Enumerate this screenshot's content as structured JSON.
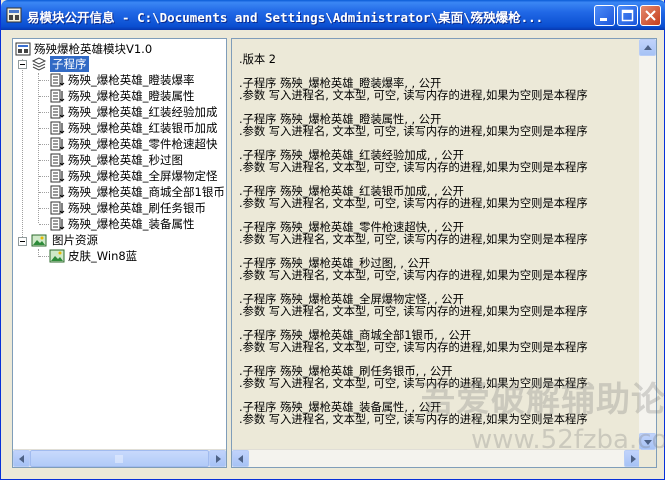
{
  "window": {
    "title": "易模块公开信息 - C:\\Documents and Settings\\Administrator\\桌面\\殇殃爆枪..."
  },
  "tree": {
    "root": "殇殃爆枪英雄模块V1.0",
    "subprograms_label": "子程序",
    "subprograms": [
      "殇殃_爆枪英雄_瞪装爆率",
      "殇殃_爆枪英雄_瞪装属性",
      "殇殃_爆枪英雄_红装经验加成",
      "殇殃_爆枪英雄_红装银币加成",
      "殇殃_爆枪英雄_零件枪速超快",
      "殇殃_爆枪英雄_秒过图",
      "殇殃_爆枪英雄_全屏爆物定怪",
      "殇殃_爆枪英雄_商城全部1银币",
      "殇殃_爆枪英雄_刷任务银币",
      "殇殃_爆枪英雄_装备属性"
    ],
    "images_label": "图片资源",
    "images": [
      "皮肤_Win8蓝"
    ]
  },
  "content": {
    "version": ".版本 2",
    "entries": [
      {
        "sub": ".子程序 殇殃_爆枪英雄_瞪装爆率, , 公开",
        "param": ".参数 写入进程名, 文本型, 可空, 读写内存的进程,如果为空则是本程序"
      },
      {
        "sub": ".子程序 殇殃_爆枪英雄_瞪装属性, , 公开",
        "param": ".参数 写入进程名, 文本型, 可空, 读写内存的进程,如果为空则是本程序"
      },
      {
        "sub": ".子程序 殇殃_爆枪英雄_红装经验加成, , 公开",
        "param": ".参数 写入进程名, 文本型, 可空, 读写内存的进程,如果为空则是本程序"
      },
      {
        "sub": ".子程序 殇殃_爆枪英雄_红装银币加成, , 公开",
        "param": ".参数 写入进程名, 文本型, 可空, 读写内存的进程,如果为空则是本程序"
      },
      {
        "sub": ".子程序 殇殃_爆枪英雄_零件枪速超快, , 公开",
        "param": ".参数 写入进程名, 文本型, 可空, 读写内存的进程,如果为空则是本程序"
      },
      {
        "sub": ".子程序 殇殃_爆枪英雄_秒过图, , 公开",
        "param": ".参数 写入进程名, 文本型, 可空, 读写内存的进程,如果为空则是本程序"
      },
      {
        "sub": ".子程序 殇殃_爆枪英雄_全屏爆物定怪, , 公开",
        "param": ".参数 写入进程名, 文本型, 可空, 读写内存的进程,如果为空则是本程序"
      },
      {
        "sub": ".子程序 殇殃_爆枪英雄_商城全部1银币, , 公开",
        "param": ".参数 写入进程名, 文本型, 可空, 读写内存的进程,如果为空则是本程序"
      },
      {
        "sub": ".子程序 殇殃_爆枪英雄_刷任务银币, , 公开",
        "param": ".参数 写入进程名, 文本型, 可空, 读写内存的进程,如果为空则是本程序"
      },
      {
        "sub": ".子程序 殇殃_爆枪英雄_装备属性, , 公开",
        "param": ".参数 写入进程名, 文本型, 可空, 读写内存的进程,如果为空则是本程序"
      }
    ]
  },
  "watermark": {
    "line1": "吾爱破解辅助论坛",
    "line2": "www.52fzba.com"
  },
  "icons": {
    "app": "module-icon",
    "subprogram": "subprogram-icon",
    "images": "image-resource-icon"
  },
  "colors": {
    "title_bar": "#2168e6",
    "selection": "#316ac5",
    "close_button": "#c53d1c"
  }
}
